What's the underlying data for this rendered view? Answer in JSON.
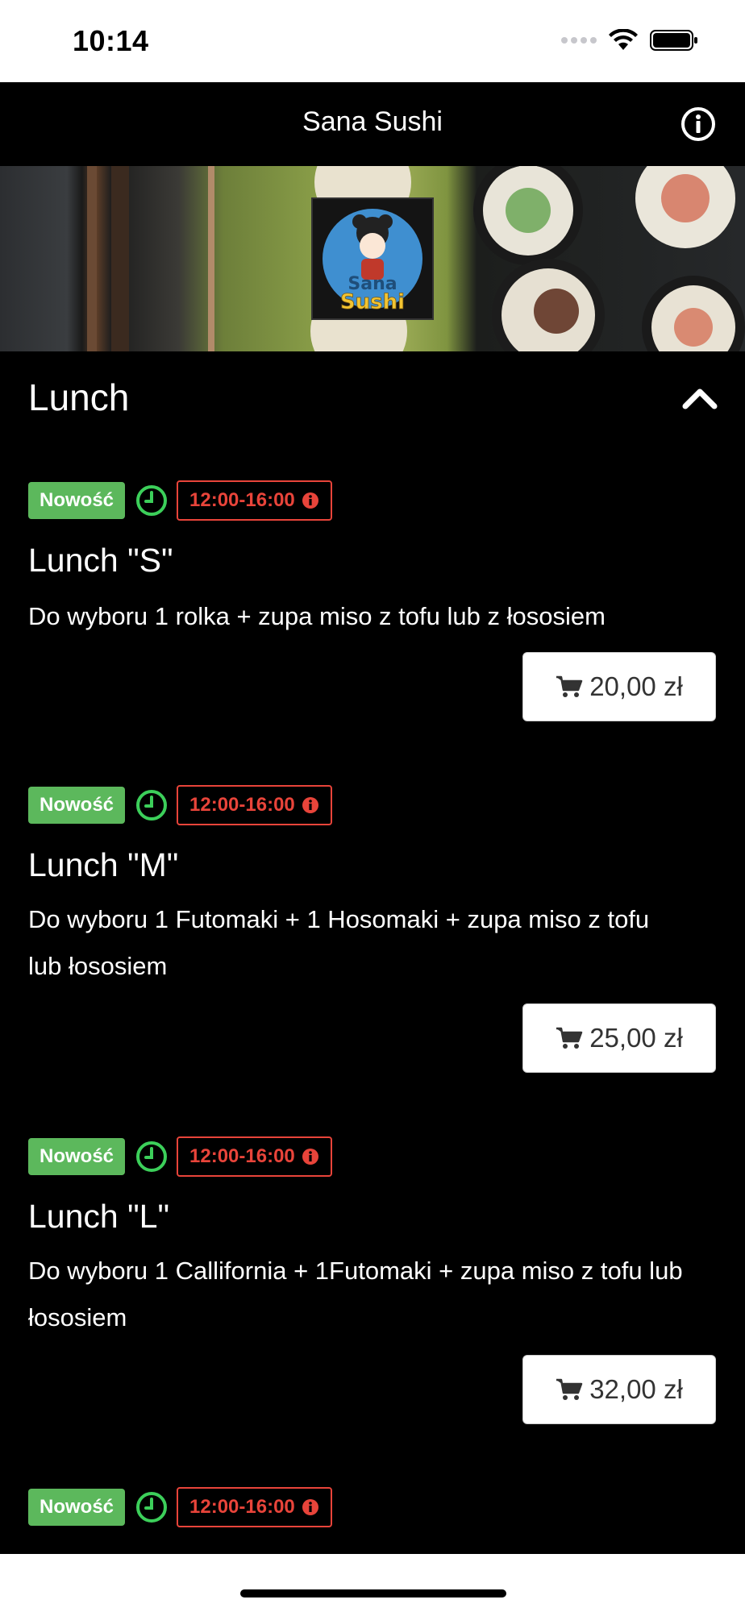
{
  "status_bar": {
    "time": "10:14"
  },
  "header": {
    "title": "Sana Sushi"
  },
  "section": {
    "title": "Lunch"
  },
  "items": [
    {
      "badge": "Nowość",
      "hours": "12:00-16:00",
      "title": "Lunch \"S\"",
      "description": "Do wyboru 1 rolka + zupa miso z tofu lub z łososiem",
      "price": "20,00 zł"
    },
    {
      "badge": "Nowość",
      "hours": "12:00-16:00",
      "title": "Lunch \"M\"",
      "description": "Do wyboru 1 Futomaki + 1 Hosomaki + zupa miso z tofu lub łososiem",
      "price": "25,00 zł"
    },
    {
      "badge": "Nowość",
      "hours": "12:00-16:00",
      "title": "Lunch \"L\"",
      "description": "Do wyboru 1 Callifornia + 1Futomaki + zupa miso z tofu lub łososiem",
      "price": "32,00 zł"
    },
    {
      "badge": "Nowość",
      "hours": "12:00-16:00"
    }
  ],
  "colors": {
    "new_badge": "#5cb85c",
    "time_badge": "#e8443a",
    "clock": "#3ccf5a"
  },
  "icons": [
    "info-icon",
    "clock-icon",
    "cart-icon",
    "chevron-up-icon",
    "wifi-icon",
    "battery-icon",
    "signal-icon"
  ]
}
